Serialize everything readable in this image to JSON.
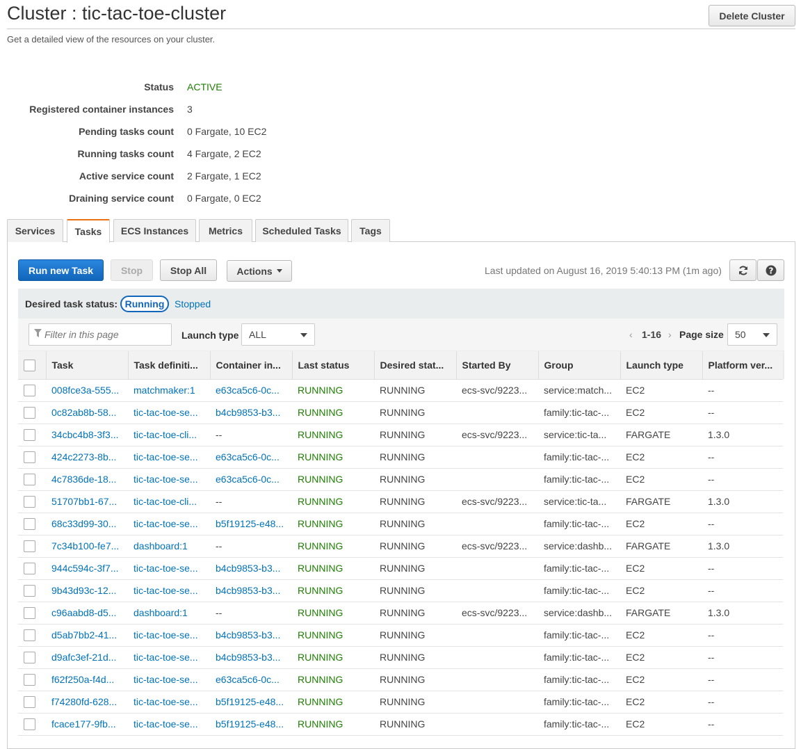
{
  "header": {
    "title": "Cluster : tic-tac-toe-cluster",
    "subtitle": "Get a detailed view of the resources on your cluster.",
    "delete_label": "Delete Cluster"
  },
  "summary": [
    {
      "label": "Status",
      "value": "ACTIVE"
    },
    {
      "label": "Registered container instances",
      "value": "3"
    },
    {
      "label": "Pending tasks count",
      "value": "0 Fargate, 10 EC2"
    },
    {
      "label": "Running tasks count",
      "value": "4 Fargate, 2 EC2"
    },
    {
      "label": "Active service count",
      "value": "2 Fargate, 1 EC2"
    },
    {
      "label": "Draining service count",
      "value": "0 Fargate, 0 EC2"
    }
  ],
  "tabs": [
    {
      "label": "Services"
    },
    {
      "label": "Tasks"
    },
    {
      "label": "ECS Instances"
    },
    {
      "label": "Metrics"
    },
    {
      "label": "Scheduled Tasks"
    },
    {
      "label": "Tags"
    }
  ],
  "selected_tab": "Tasks",
  "toolbar": {
    "run_label": "Run new Task",
    "stop_label": "Stop",
    "stop_all_label": "Stop All",
    "actions_label": "Actions",
    "last_updated": "Last updated on August 16, 2019 5:40:13 PM (1m ago)",
    "refresh_icon": "refresh-icon",
    "help_icon": "help-icon"
  },
  "filters": {
    "desired_status_label": "Desired task status:",
    "running_label": "Running",
    "stopped_label": "Stopped",
    "filter_placeholder": "Filter in this page",
    "launch_type_label": "Launch type",
    "launch_type_value": "ALL",
    "pager_range": "1-16",
    "page_size_label": "Page size",
    "page_size_value": "50"
  },
  "table": {
    "columns": [
      "Task",
      "Task definiti...",
      "Container in...",
      "Last status",
      "Desired stat...",
      "Started By",
      "Group",
      "Launch type",
      "Platform ver..."
    ],
    "rows": [
      [
        "008fce3a-555...",
        "matchmaker:1",
        "e63ca5c6-0c...",
        "RUNNING",
        "RUNNING",
        "ecs-svc/9223...",
        "service:match...",
        "EC2",
        "--"
      ],
      [
        "0c82ab8b-58...",
        "tic-tac-toe-se...",
        "b4cb9853-b3...",
        "RUNNING",
        "RUNNING",
        "",
        "family:tic-tac-...",
        "EC2",
        "--"
      ],
      [
        "34cbc4b8-3f3...",
        "tic-tac-toe-cli...",
        "--",
        "RUNNING",
        "RUNNING",
        "ecs-svc/9223...",
        "service:tic-ta...",
        "FARGATE",
        "1.3.0"
      ],
      [
        "424c2273-8b...",
        "tic-tac-toe-se...",
        "e63ca5c6-0c...",
        "RUNNING",
        "RUNNING",
        "",
        "family:tic-tac-...",
        "EC2",
        "--"
      ],
      [
        "4c7836de-18...",
        "tic-tac-toe-se...",
        "e63ca5c6-0c...",
        "RUNNING",
        "RUNNING",
        "",
        "family:tic-tac-...",
        "EC2",
        "--"
      ],
      [
        "51707bb1-67...",
        "tic-tac-toe-cli...",
        "--",
        "RUNNING",
        "RUNNING",
        "ecs-svc/9223...",
        "service:tic-ta...",
        "FARGATE",
        "1.3.0"
      ],
      [
        "68c33d99-30...",
        "tic-tac-toe-se...",
        "b5f19125-e48...",
        "RUNNING",
        "RUNNING",
        "",
        "family:tic-tac-...",
        "EC2",
        "--"
      ],
      [
        "7c34b100-fe7...",
        "dashboard:1",
        "--",
        "RUNNING",
        "RUNNING",
        "ecs-svc/9223...",
        "service:dashb...",
        "FARGATE",
        "1.3.0"
      ],
      [
        "944c594c-3f7...",
        "tic-tac-toe-se...",
        "b4cb9853-b3...",
        "RUNNING",
        "RUNNING",
        "",
        "family:tic-tac-...",
        "EC2",
        "--"
      ],
      [
        "9b43d93c-12...",
        "tic-tac-toe-se...",
        "b4cb9853-b3...",
        "RUNNING",
        "RUNNING",
        "",
        "family:tic-tac-...",
        "EC2",
        "--"
      ],
      [
        "c96aabd8-d5...",
        "dashboard:1",
        "--",
        "RUNNING",
        "RUNNING",
        "ecs-svc/9223...",
        "service:dashb...",
        "FARGATE",
        "1.3.0"
      ],
      [
        "d5ab7bb2-41...",
        "tic-tac-toe-se...",
        "b4cb9853-b3...",
        "RUNNING",
        "RUNNING",
        "",
        "family:tic-tac-...",
        "EC2",
        "--"
      ],
      [
        "d9afc3ef-21d...",
        "tic-tac-toe-se...",
        "b4cb9853-b3...",
        "RUNNING",
        "RUNNING",
        "",
        "family:tic-tac-...",
        "EC2",
        "--"
      ],
      [
        "f62f250a-f4d...",
        "tic-tac-toe-se...",
        "e63ca5c6-0c...",
        "RUNNING",
        "RUNNING",
        "",
        "family:tic-tac-...",
        "EC2",
        "--"
      ],
      [
        "f74280fd-628...",
        "tic-tac-toe-se...",
        "b5f19125-e48...",
        "RUNNING",
        "RUNNING",
        "",
        "family:tic-tac-...",
        "EC2",
        "--"
      ],
      [
        "fcace177-9fb...",
        "tic-tac-toe-se...",
        "b5f19125-e48...",
        "RUNNING",
        "RUNNING",
        "",
        "family:tic-tac-...",
        "EC2",
        "--"
      ]
    ]
  },
  "colors": {
    "primary": "#1166bb",
    "link": "#0073bb",
    "status_green": "#1d8102",
    "tab_accent": "#ec7211"
  }
}
